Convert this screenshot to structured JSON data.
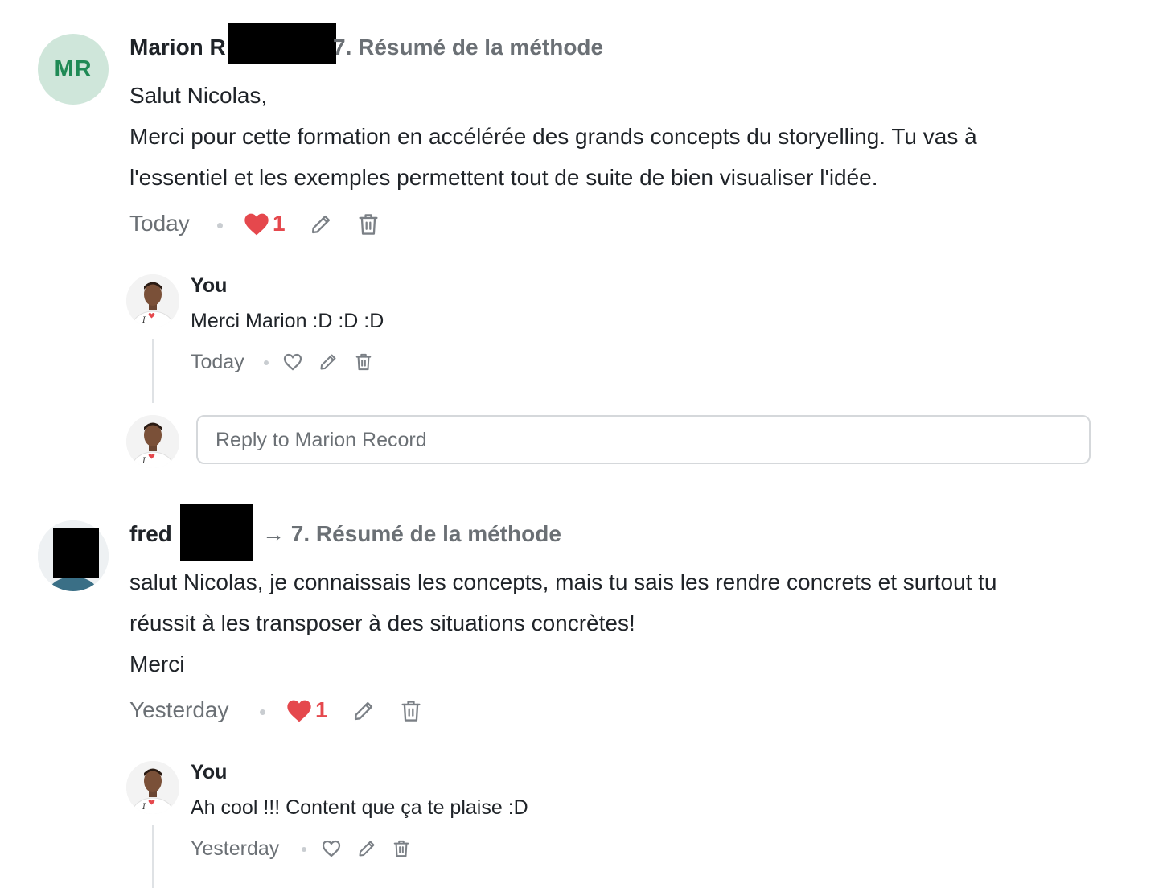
{
  "comments": [
    {
      "author": "Marion R",
      "avatar_initials": "MR",
      "context": "7. Résumé de la méthode",
      "body": [
        "Salut Nicolas,",
        "Merci pour cette formation en accélérée des grands concepts du storyelling. Tu vas à",
        "l'essentiel et les exemples permettent tout de suite de bien visualiser l'idée."
      ],
      "time": "Today",
      "likes": "1",
      "reply": {
        "author": "You",
        "body": "Merci Marion :D :D :D",
        "time": "Today"
      },
      "reply_input_placeholder": "Reply to Marion Record"
    },
    {
      "author": "fred",
      "context": "→ 7. Résumé de la méthode",
      "body": [
        "salut Nicolas, je connaissais les concepts, mais tu sais les rendre concrets et surtout tu",
        "réussit à les transposer à des situations concrètes!",
        "Merci"
      ],
      "time": "Yesterday",
      "likes": "1",
      "reply": {
        "author": "You",
        "body": "Ah cool !!! Content que ça te plaise :D",
        "time": "Yesterday"
      }
    }
  ],
  "avatar_shirt_text": "I",
  "icons": [
    "heart-filled-icon",
    "heart-outline-icon",
    "pencil-icon",
    "trash-icon"
  ],
  "colors": {
    "like": "#e5484d",
    "muted": "#6b7075",
    "avatar_bg": "#cfe6da",
    "avatar_fg": "#1f8a55"
  }
}
